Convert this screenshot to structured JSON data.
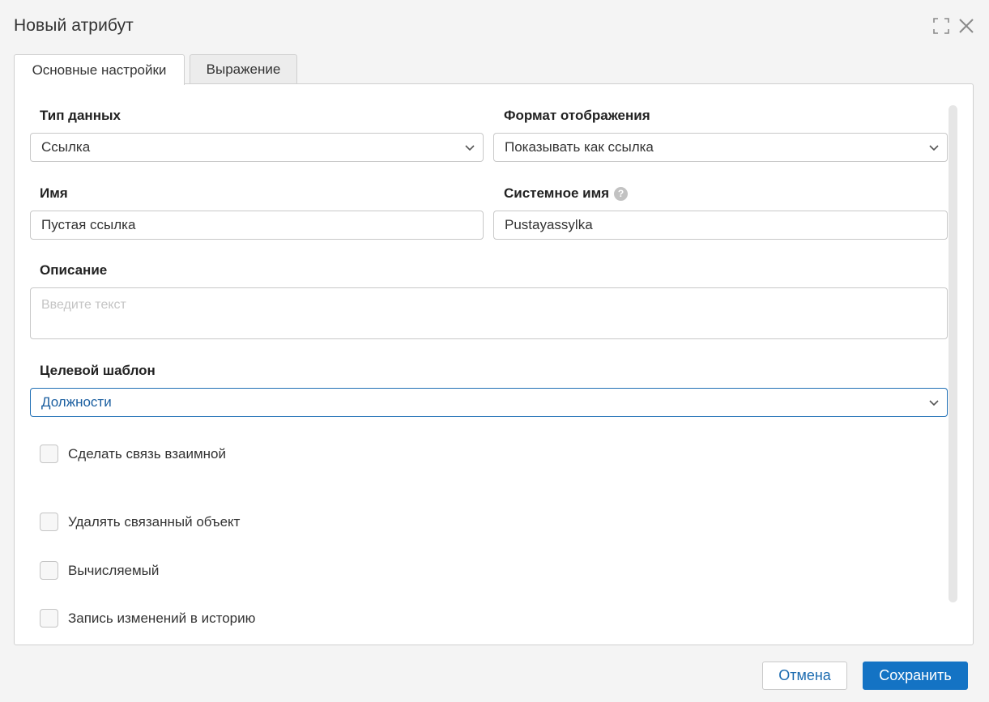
{
  "dialog": {
    "title": "Новый атрибут"
  },
  "tabs": [
    {
      "label": "Основные настройки",
      "active": true
    },
    {
      "label": "Выражение",
      "active": false
    }
  ],
  "form": {
    "data_type": {
      "label": "Тип данных",
      "value": "Ссылка"
    },
    "display_format": {
      "label": "Формат отображения",
      "value": "Показывать как ссылка"
    },
    "name": {
      "label": "Имя",
      "value": "Пустая ссылка"
    },
    "system_name": {
      "label": "Системное имя",
      "value": "Pustayassylka",
      "help_icon": "?"
    },
    "description": {
      "label": "Описание",
      "placeholder": "Введите текст",
      "value": ""
    },
    "target_template": {
      "label": "Целевой шаблон",
      "value": "Должности"
    },
    "checkboxes": [
      {
        "label": "Сделать связь взаимной",
        "checked": false
      },
      {
        "label": "Удалять связанный объект",
        "checked": false
      },
      {
        "label": "Вычисляемый",
        "checked": false
      },
      {
        "label": "Запись изменений в историю",
        "checked": false
      }
    ]
  },
  "buttons": {
    "cancel": "Отмена",
    "save": "Сохранить"
  },
  "colors": {
    "accent": "#1473c4",
    "focus_border": "#1f6fb5",
    "background": "#f4f4f4"
  }
}
